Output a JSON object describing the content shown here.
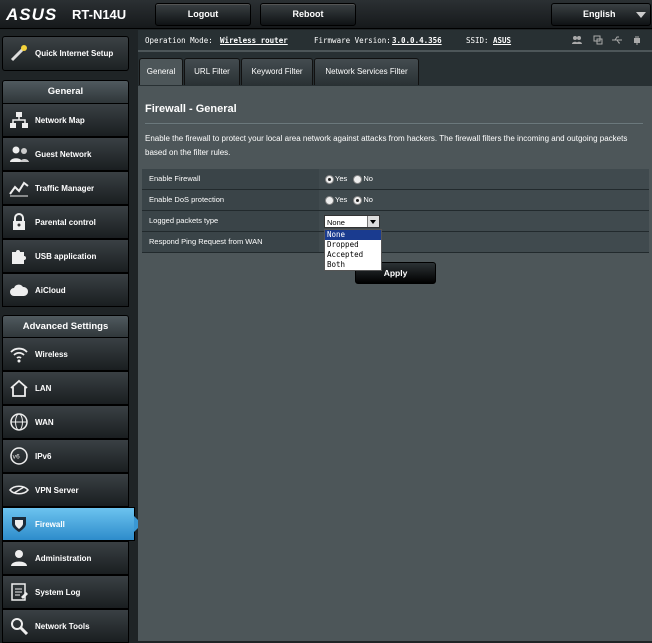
{
  "header": {
    "logo": "ASUS",
    "model": "RT-N14U",
    "logout_label": "Logout",
    "reboot_label": "Reboot",
    "language": "English"
  },
  "status": {
    "op_mode_label": "Operation Mode:",
    "op_mode_value": "Wireless router",
    "fw_label": "Firmware Version:",
    "fw_value": "3.0.0.4.356",
    "ssid_label": "SSID:",
    "ssid_value": "ASUS"
  },
  "sidebar": {
    "qis_label": "Quick Internet Setup",
    "general_header": "General",
    "general_items": [
      {
        "label": "Network Map",
        "icon": "network-map-icon"
      },
      {
        "label": "Guest Network",
        "icon": "guest-network-icon"
      },
      {
        "label": "Traffic Manager",
        "icon": "traffic-manager-icon"
      },
      {
        "label": "Parental control",
        "icon": "lock-icon"
      },
      {
        "label": "USB application",
        "icon": "puzzle-icon"
      },
      {
        "label": "AiCloud",
        "icon": "cloud-icon"
      }
    ],
    "advanced_header": "Advanced Settings",
    "advanced_items": [
      {
        "label": "Wireless",
        "icon": "wireless-icon"
      },
      {
        "label": "LAN",
        "icon": "home-icon"
      },
      {
        "label": "WAN",
        "icon": "globe-icon"
      },
      {
        "label": "IPv6",
        "icon": "ipv6-icon"
      },
      {
        "label": "VPN Server",
        "icon": "vpn-icon"
      },
      {
        "label": "Firewall",
        "icon": "firewall-icon"
      },
      {
        "label": "Administration",
        "icon": "user-icon"
      },
      {
        "label": "System Log",
        "icon": "log-icon"
      },
      {
        "label": "Network Tools",
        "icon": "tools-icon"
      }
    ],
    "active_item": "Firewall"
  },
  "tabs": [
    "General",
    "URL Filter",
    "Keyword Filter",
    "Network Services Filter"
  ],
  "page": {
    "title": "Firewall - General",
    "description": "Enable the firewall to protect your local area network against attacks from hackers. The firewall filters the incoming and outgoing packets based on the filter rules.",
    "rows": {
      "enable_firewall": "Enable Firewall",
      "enable_dos": "Enable DoS protection",
      "logged_packets": "Logged packets type",
      "respond_ping": "Respond Ping Request from WAN"
    },
    "yes_label": "Yes",
    "no_label": "No",
    "select_value": "None",
    "dropdown_options": [
      "None",
      "Dropped",
      "Accepted",
      "Both"
    ],
    "apply_label": "Apply"
  },
  "colors": {
    "accent": "#2d8ccb",
    "panel": "#4d5659",
    "dropdown_highlight": "#1a3b8f"
  }
}
